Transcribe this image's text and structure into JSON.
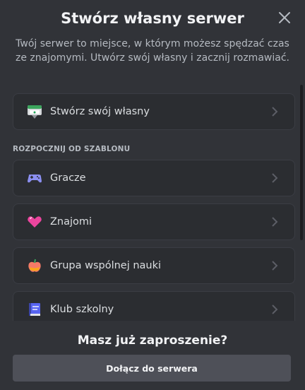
{
  "modal": {
    "title": "Stwórz własny serwer",
    "subtitle": "Twój serwer to miejsce, w którym możesz spędzać czas ze znajomymi. Utwórz swój własny i zacznij rozmawiać."
  },
  "create_own": {
    "label": "Stwórz swój własny",
    "icon": "create-server-icon"
  },
  "templates": {
    "section_label": "ROZPOCZNIJ OD SZABLONU",
    "items": [
      {
        "label": "Gracze",
        "icon": "gamepad-icon"
      },
      {
        "label": "Znajomi",
        "icon": "heart-icon"
      },
      {
        "label": "Grupa wspólnej nauki",
        "icon": "apple-icon"
      },
      {
        "label": "Klub szkolny",
        "icon": "book-icon"
      }
    ]
  },
  "footer": {
    "title": "Masz już zaproszenie?",
    "join_label": "Dołącz do serwera"
  },
  "colors": {
    "background": "#313338",
    "card": "#2b2d31",
    "button": "#4e5058"
  }
}
